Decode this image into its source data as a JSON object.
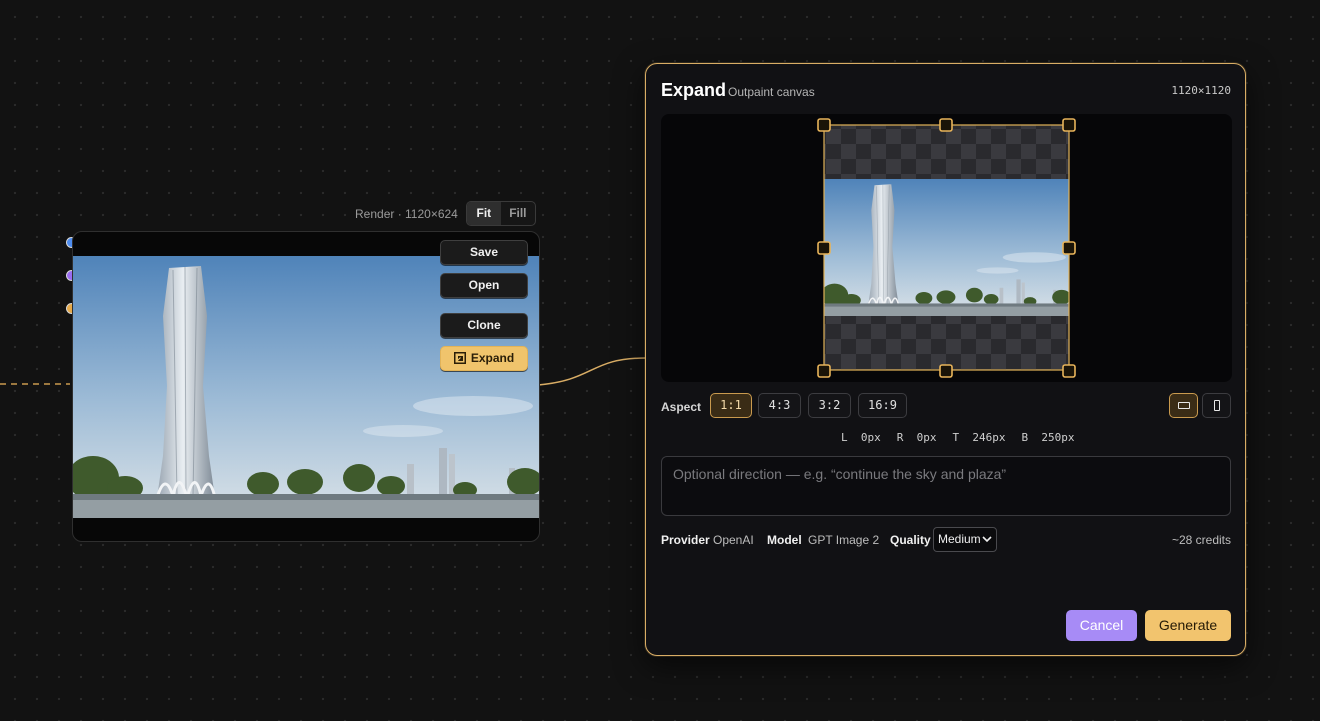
{
  "render_node": {
    "caption": "Render · 1120×624",
    "view_modes": [
      "Fit",
      "Fill"
    ],
    "active_view_mode": "Fit",
    "image_alt": "Twisted white skyscraper beside a plaza with trees under a blue sky",
    "actions": {
      "save": "Save",
      "open": "Open",
      "clone": "Clone",
      "expand": "Expand"
    },
    "ports": [
      "blue-input-port",
      "purple-input-port",
      "orange-input-port"
    ]
  },
  "expand_panel": {
    "title": "Expand",
    "subtitle": "Outpaint canvas",
    "dimensions": "1120×1120",
    "aspect_label": "Aspect",
    "aspect_options": [
      "1:1",
      "4:3",
      "3:2",
      "16:9"
    ],
    "active_aspect": "1:1",
    "orientation": "landscape",
    "padding": {
      "left": "L  0px",
      "right": "R  0px",
      "top": "T  246px",
      "bottom": "B  250px"
    },
    "direction_placeholder": "Optional direction — e.g. “continue the sky and plaza”",
    "direction_value": "",
    "provider_label": "Provider",
    "provider_value": "OpenAI",
    "model_label": "Model",
    "model_value": "GPT Image 2",
    "quality_label": "Quality",
    "quality_value": "Medium",
    "credits": "~28 credits",
    "cancel_label": "Cancel",
    "generate_label": "Generate"
  },
  "colors": {
    "canvas_bg": "#121212",
    "accent_gold": "#d9ad65",
    "cancel_purple": "#a78bf6",
    "generate_gold": "#f2c46e"
  }
}
